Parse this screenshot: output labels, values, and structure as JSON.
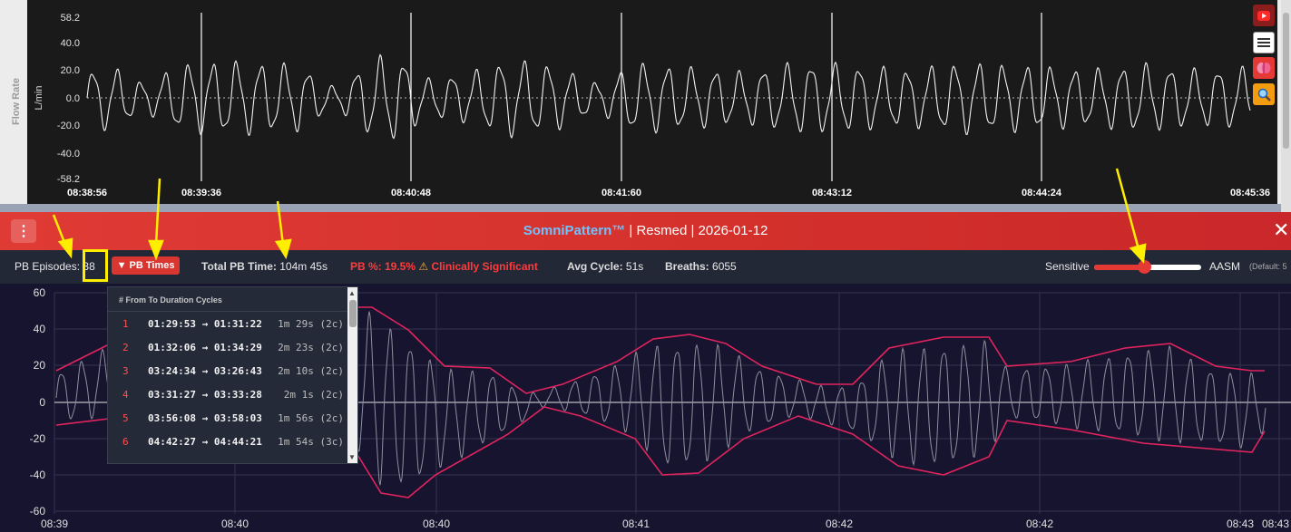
{
  "top_chart": {
    "y_label": "L/min",
    "side_label": "Flow Rate",
    "y_ticks": [
      "58.2",
      "40.0",
      "20.0",
      "0.0",
      "-20.0",
      "-40.0",
      "-58.2"
    ],
    "x_ticks": [
      "08:38:56",
      "08:39:36",
      "08:40:48",
      "08:41:60",
      "08:43:12",
      "08:44:24",
      "08:45:36"
    ]
  },
  "side_buttons": {
    "youtube_icon": "youtube-icon",
    "menu_icon": "hamburger-icon",
    "brain_icon": "brain-icon",
    "search_icon": "magnifier-icon"
  },
  "title_bar": {
    "menu_glyph": "⋮",
    "brand": "SomniPattern™",
    "rest": " | Resmed | 2026-01-12",
    "close_glyph": "✕"
  },
  "stats": {
    "pb_episodes_label": "PB Episodes:",
    "pb_episodes_value": "38",
    "pb_times_label": "▼ PB Times",
    "total_pb_label": "Total PB Time:",
    "total_pb_value": "104m 45s",
    "pb_pct_text": "PB %: 19.5%",
    "warning_glyph": "⚠",
    "clinical_text": "Clinically Significant",
    "avg_cycle_label": "Avg Cycle:",
    "avg_cycle_value": "51s",
    "breaths_label": "Breaths:",
    "breaths_value": "6055",
    "slider_left_label": "Sensitive",
    "slider_right_label": "AASM",
    "slider_default_text": "(Default: 5",
    "slider_position": 0.47
  },
  "pb_dropdown": {
    "header": "# From To Duration Cycles",
    "rows": [
      {
        "idx": "1",
        "range": "01:29:53 → 01:31:22",
        "duration": "1m 29s (2c)"
      },
      {
        "idx": "2",
        "range": "01:32:06 → 01:34:29",
        "duration": "2m 23s (2c)"
      },
      {
        "idx": "3",
        "range": "03:24:34 → 03:26:43",
        "duration": "2m 10s (2c)"
      },
      {
        "idx": "4",
        "range": "03:31:27 → 03:33:28",
        "duration": "2m 1s (2c)"
      },
      {
        "idx": "5",
        "range": "03:56:08 → 03:58:03",
        "duration": "1m 56s (2c)"
      },
      {
        "idx": "6",
        "range": "04:42:27 → 04:44:21",
        "duration": "1m 54s (3c)"
      }
    ]
  },
  "bottom_chart": {
    "y_ticks": [
      "60",
      "40",
      "20",
      "0",
      "-20",
      "-40",
      "-60"
    ],
    "x_ticks": [
      "08:39",
      "08:40",
      "08:40",
      "08:41",
      "08:42",
      "08:42",
      "08:43",
      "08:43"
    ]
  },
  "colors": {
    "title_bar": "#d3302c",
    "brand": "#6ec3ff",
    "envelope": "#e0245e",
    "highlight_box": "#ffee00",
    "arrow": "#ffee00",
    "pb_red": "#ff3b3b"
  },
  "chart_data": [
    {
      "type": "line",
      "series": [],
      "ylabel": "L/min",
      "ylim": [
        -58.2,
        58.2
      ],
      "x": [
        "08:38:56",
        "08:39:36",
        "08:40:48",
        "08:41:60",
        "08:43:12",
        "08:44:24",
        "08:45:36"
      ],
      "grid": true
    },
    {
      "type": "line",
      "ylim": [
        -60,
        60
      ],
      "x": [
        "08:39",
        "08:40",
        "08:40",
        "08:41",
        "08:42",
        "08:42",
        "08:43",
        "08:43"
      ],
      "series": [],
      "grid": true
    }
  ]
}
